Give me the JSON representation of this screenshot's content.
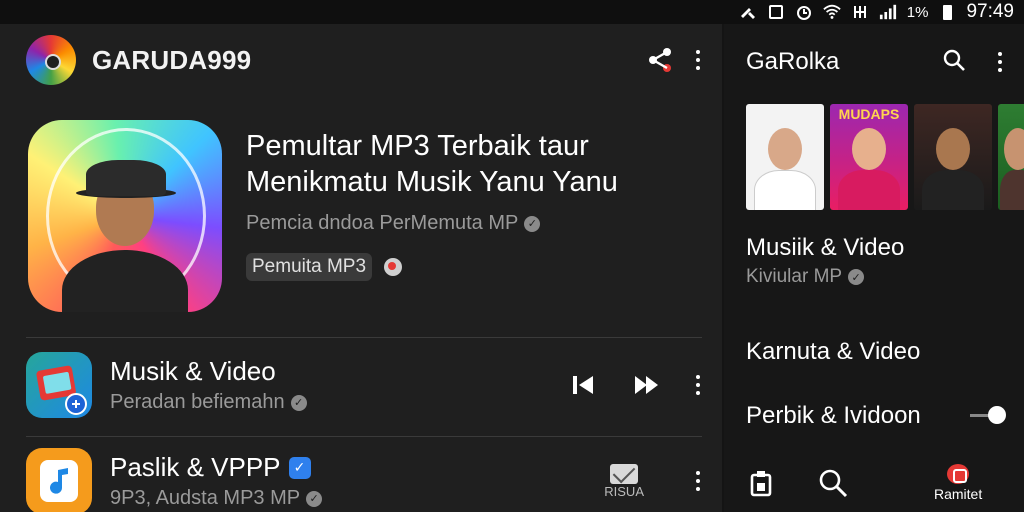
{
  "status": {
    "time": "97:49",
    "battery": "1%"
  },
  "header": {
    "app_title": "GARUDA999",
    "icons": [
      "share-icon",
      "more-vert-icon"
    ]
  },
  "hero": {
    "title": "Pemultar MP3 Terbaik  taur Menikmatu Musik Yanu Yanu",
    "subtitle": "Pemcia dndoa PerMemuta MP",
    "chip": "Pemuita MP3"
  },
  "rows": [
    {
      "title": "Musik & Video",
      "subtitle": "Peradan befiemahn",
      "icons": [
        "video-app-icon",
        "skip-back-icon",
        "skip-forward-icon",
        "more-vert-icon"
      ]
    },
    {
      "title": "Paslik & VPPP",
      "subtitle": "9P3, Audsta MP3 MP",
      "action_label": "RISUA",
      "icons": [
        "music-note-app-icon",
        "mail-icon",
        "more-vert-icon"
      ]
    }
  ],
  "right": {
    "title": "GaRolka",
    "thumb_label": "MUDAPS",
    "card_title": "Musiik & Video",
    "card_sub": "Kiviular MP",
    "item1": "Karnuta & Video",
    "item2": "Perbik & Ividoon",
    "nav_label": "Ramitet"
  },
  "colors": {
    "accent_red": "#e53935",
    "verified_blue": "#2f80ed",
    "panel_left": "#1f1f1f",
    "panel_right": "#171717"
  }
}
